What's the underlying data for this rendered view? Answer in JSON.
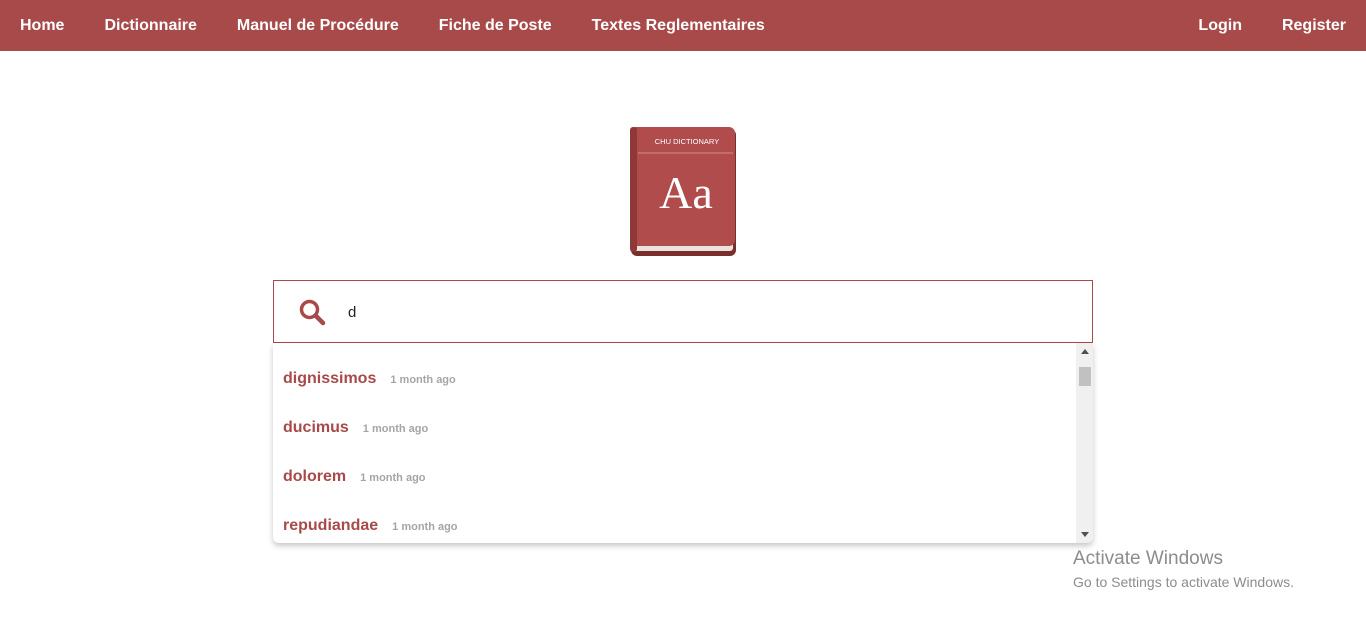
{
  "colors": {
    "brand": "#a84a4a",
    "muted": "#a5a5a5"
  },
  "nav": {
    "left": [
      "Home",
      "Dictionnaire",
      "Manuel de Procédure",
      "Fiche de Poste",
      "Textes Reglementaires"
    ],
    "right": [
      "Login",
      "Register"
    ]
  },
  "logo": {
    "header": "CHU DICTIONARY",
    "letters": "Aa"
  },
  "search": {
    "icon": "search-icon",
    "value": "d",
    "placeholder": ""
  },
  "suggestions": [
    {
      "word": "dignissimos",
      "time": "1 month ago"
    },
    {
      "word": "ducimus",
      "time": "1 month ago"
    },
    {
      "word": "dolorem",
      "time": "1 month ago"
    },
    {
      "word": "repudiandae",
      "time": "1 month ago"
    }
  ],
  "activation": {
    "title": "Activate Windows",
    "subtitle": "Go to Settings to activate Windows."
  }
}
